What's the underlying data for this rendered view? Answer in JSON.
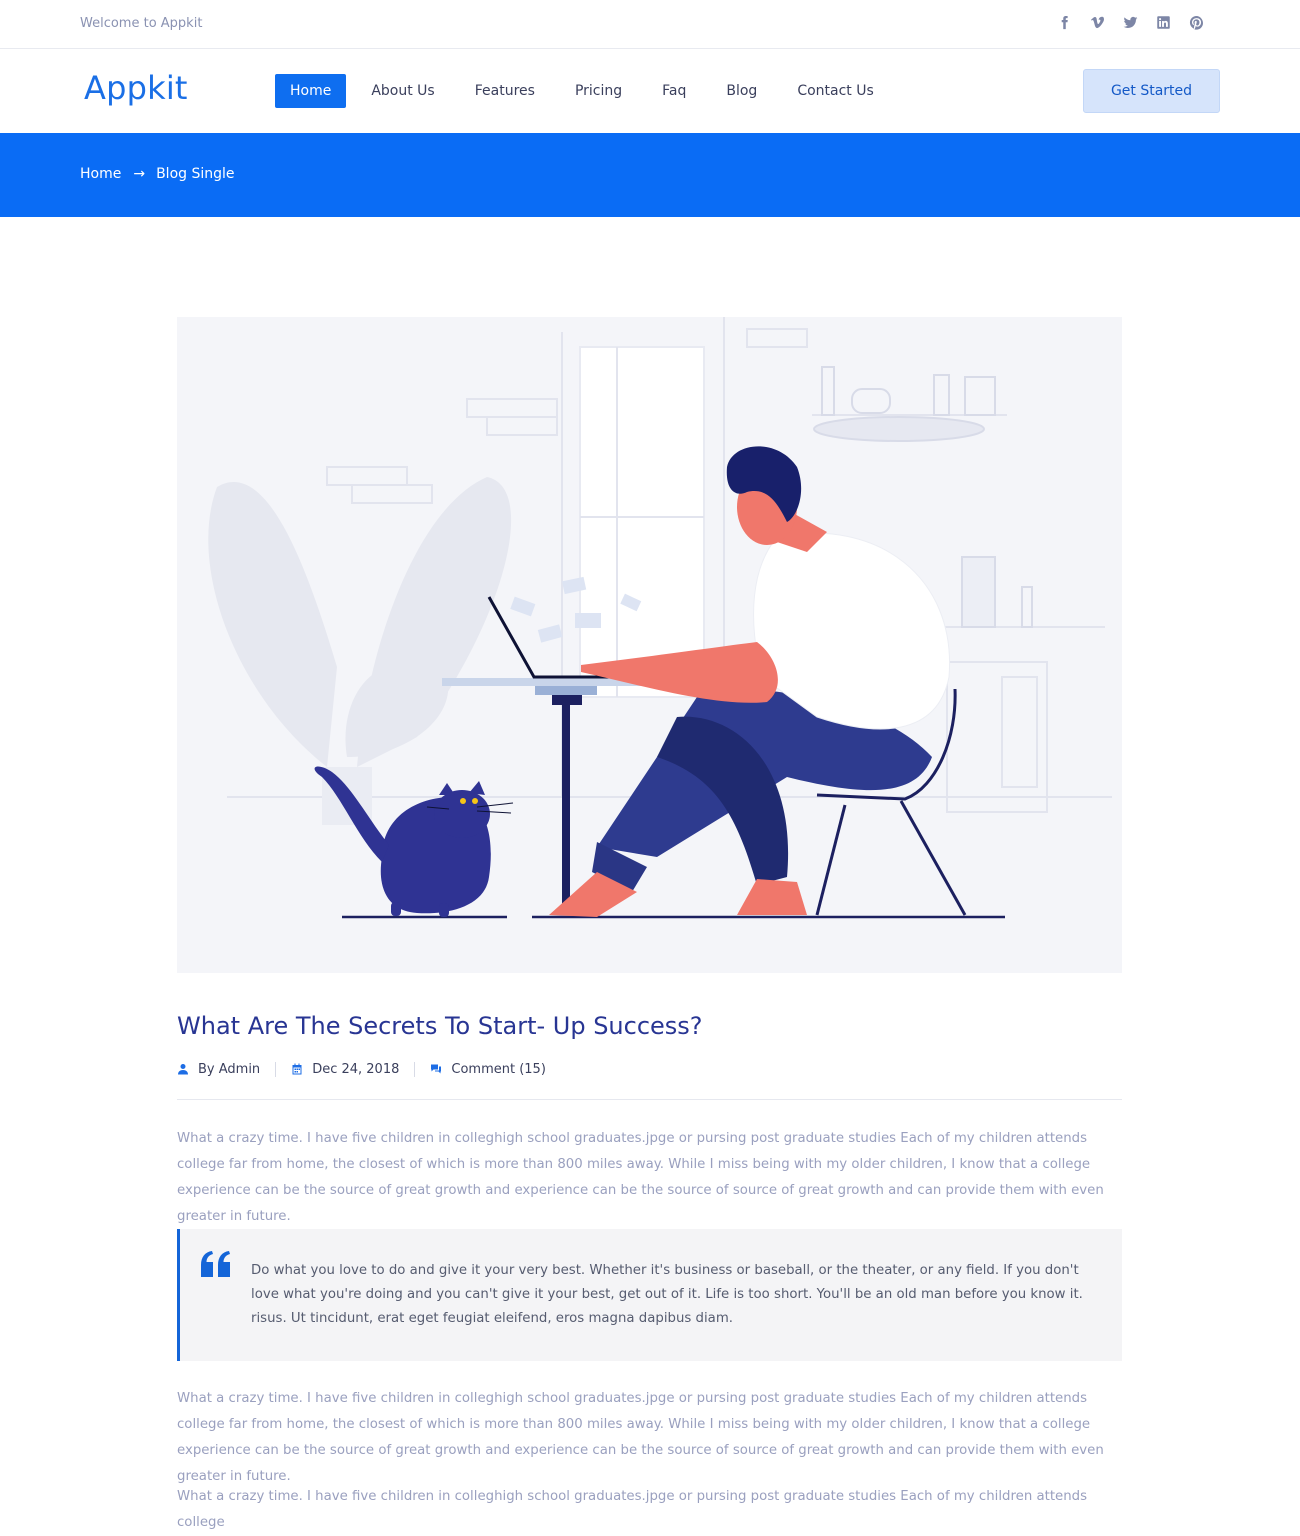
{
  "topbar": {
    "welcome": "Welcome to Appkit",
    "socials": [
      "facebook-icon",
      "vimeo-icon",
      "twitter-icon",
      "linkedin-icon",
      "pinterest-icon"
    ]
  },
  "header": {
    "logo": "Appkit",
    "nav": [
      "Home",
      "About Us",
      "Features",
      "Pricing",
      "Faq",
      "Blog",
      "Contact Us"
    ],
    "active_nav": "Home",
    "cta": "Get Started"
  },
  "breadcrumb": {
    "home": "Home",
    "arrow": "→",
    "current": "Blog Single"
  },
  "post": {
    "title": "What Are The Secrets To Start- Up Success?",
    "author": "By Admin",
    "date": "Dec 24, 2018",
    "comments": "Comment (15)",
    "paragraph_1": "What a crazy time. I have five children in colleghigh school graduates.jpge or pursing post graduate studies Each of my children attends college far from home, the closest of which is more than 800 miles away. While I miss being with my older children, I know that a college experience can be the source of great growth and experience can be the source of source of great growth and can provide them with even greater in future.",
    "quote": "Do what you love to do and give it your very best. Whether it's business or baseball, or the theater, or any field. If you don't love what you're doing and you can't give it your best, get out of it. Life is too short. You'll be an old man before you know it. risus. Ut tincidunt, erat eget feugiat eleifend, eros magna dapibus diam.",
    "paragraph_2": "What a crazy time. I have five children in colleghigh school graduates.jpge or pursing post graduate studies Each of my children attends college far from home, the closest of which is more than 800 miles away. While I miss being with my older children, I know that a college experience can be the source of great growth and experience can be the source of source of great growth and can provide them with even greater in future.",
    "paragraph_3": "What a crazy time. I have five children in colleghigh school graduates.jpge or pursing post graduate studies Each of my children attends college"
  },
  "colors": {
    "primary": "#0a6cf5",
    "title": "#283593",
    "body_text": "#9aa0bf",
    "cta_bg": "#d6e4fb"
  }
}
